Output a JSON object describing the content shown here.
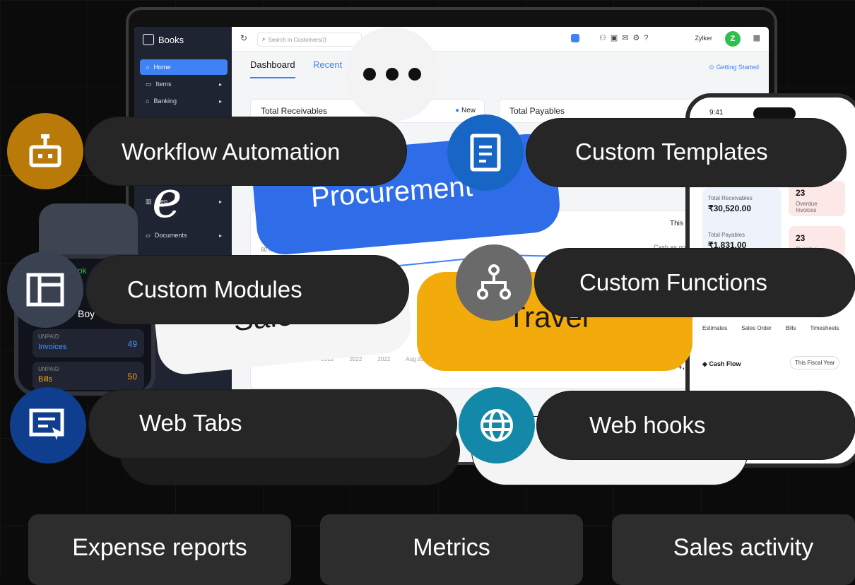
{
  "app": {
    "name": "Books",
    "search_placeholder": "Search in Customers(/)",
    "org_name": "Zylker",
    "avatar_initial": "Z",
    "sidebar": [
      {
        "label": "Home",
        "active": true
      },
      {
        "label": "Items"
      },
      {
        "label": "Banking"
      },
      {
        "label": "Rep"
      },
      {
        "label": "Documents"
      }
    ],
    "tabs": [
      "Dashboard",
      "Recent"
    ],
    "getting_started": "Getting Started",
    "cards": {
      "total_receivables": "Total Receivables",
      "new_label": "New",
      "total_payables": "Total Payables",
      "this_fiscal": "This Fis",
      "cash_as_on": "Cash as on 03",
      "y_tick": "60 K",
      "value_fragment": "94,2",
      "years": [
        "2022",
        "2022",
        "2022",
        "2022",
        "Aug 2022",
        "2022"
      ]
    }
  },
  "phone": {
    "time": "9:41",
    "total_receivables_label": "Total Receivables",
    "total_receivables_value": "₹30,520.00",
    "overdue_count_1": "23",
    "overdue_label_1": "Overdue Invoices",
    "total_payables_label": "Total Payables",
    "total_payables_value": "₹1,831.00",
    "overdue_count_2": "23",
    "overdue_label_2": "Overdue",
    "bottom_tabs": [
      "Estimates",
      "Sales Order",
      "Bills",
      "Timesheets"
    ],
    "cash_flow": "Cash Flow",
    "fiscal_select": "This Fiscal Year"
  },
  "watch": {
    "title_fragment": "ok",
    "name_fragment": "Boy",
    "rows": [
      {
        "status": "UNPAID",
        "label": "Invoices",
        "count": "49",
        "color": "#4a90ff"
      },
      {
        "status": "UNPAID",
        "label": "Bills",
        "count": "50",
        "color": "#f0a020"
      }
    ]
  },
  "decor": {
    "procurement": "Procurement",
    "travel": "Travel",
    "sales": "Sales",
    "e_mark": "e"
  },
  "features": {
    "workflow_automation": {
      "label": "Workflow Automation",
      "icon": "robot-icon",
      "color": "#b97a0a"
    },
    "custom_templates": {
      "label": "Custom Templates",
      "icon": "document-icon",
      "color": "#1766c6"
    },
    "custom_modules": {
      "label": "Custom Modules",
      "icon": "layout-icon",
      "color": "#3a4252"
    },
    "custom_functions": {
      "label": "Custom Functions",
      "icon": "hierarchy-icon",
      "color": "#6a6a6a"
    },
    "web_tabs": {
      "label": "Web Tabs",
      "icon": "web-tab-icon",
      "color": "#0f3e8f"
    },
    "web_hooks": {
      "label": "Web hooks",
      "icon": "globe-icon",
      "color": "#1488a8"
    }
  },
  "tags": [
    "Expense reports",
    "Metrics",
    "Sales activity"
  ]
}
